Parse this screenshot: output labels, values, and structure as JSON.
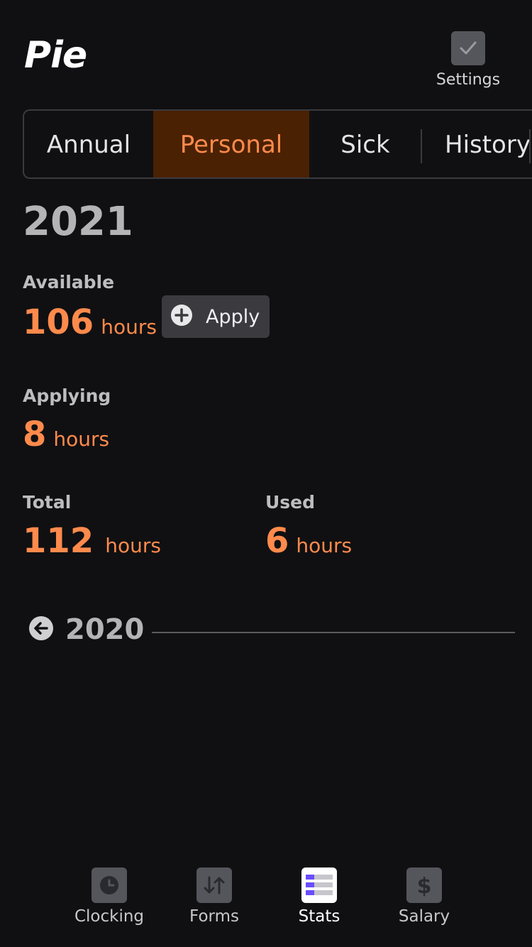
{
  "header": {
    "app_title": "Pie",
    "settings_label": "Settings"
  },
  "tabs": [
    {
      "label": "Annual",
      "active": false
    },
    {
      "label": "Personal",
      "active": true
    },
    {
      "label": "Sick",
      "active": false
    },
    {
      "label": "History",
      "active": false
    }
  ],
  "year": "2021",
  "available": {
    "label": "Available",
    "value": "106",
    "unit": "hours"
  },
  "apply_button": {
    "label": "Apply"
  },
  "applying": {
    "label": "Applying",
    "value": "8",
    "unit": "hours"
  },
  "total": {
    "label": "Total",
    "value": "112",
    "unit": "hours"
  },
  "used": {
    "label": "Used",
    "value": "6",
    "unit": "hours"
  },
  "previous_year": {
    "label": "2020"
  },
  "bottom_nav": [
    {
      "label": "Clocking",
      "icon": "clock-icon",
      "active": false
    },
    {
      "label": "Forms",
      "icon": "swap-arrows-icon",
      "active": false
    },
    {
      "label": "Stats",
      "icon": "stats-list-icon",
      "active": true
    },
    {
      "label": "Salary",
      "icon": "dollar-icon",
      "active": false
    }
  ],
  "colors": {
    "background": "#101012",
    "accent": "#ff8a4c",
    "active_tab_bg": "#4a2103",
    "stats_icon_bars": "#6b4cff"
  }
}
